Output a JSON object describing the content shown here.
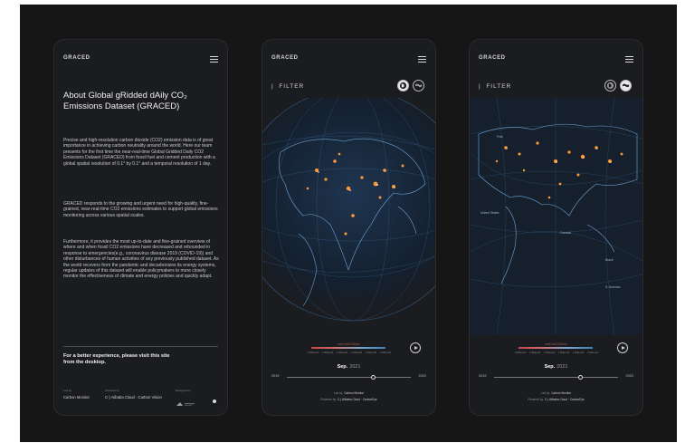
{
  "brand": "GRACED",
  "about": {
    "title_line1": "About Global gRidded dAily CO₂",
    "title_line2": "Emissions Dataset (GRACED)",
    "paragraph1": "Precise and high-resolution carbon dioxide (CO2) emission data is of great importance in achieving carbon neutrality around the world. Here our team presents for the first time the near-real-time Global Gridded Daily CO2 Emissions Dataset (GRACED) from fossil fuel and cement production with a global spatial resolution of 0.1° by 0.1° and a temporal resolution of 1 day.",
    "paragraph2": "GRACED responds to the growing and urgent need for high-quality, fine-grained, near-real-time CO2 emissions estimates to support global emissions monitoring across various spatial scales.",
    "paragraph3": "Furthermore, it provides the most up-to-date and fine-grained overview of where and when fossil CO2 emissions have decreased and rebounded in response to emergencies(e.g., coronavirus disease 2019 (COVID-19)) and other disturbances of human activities of any previously published dataset. As the world recovers from the pandemic and decarbonizes its energy systems, regular updates of this dataset will enable policymakers to more closely monitor the effectiveness of climate and energy policies and quickly adapt.",
    "visit_line1": "For a better experience, please visit this site",
    "visit_line2": "from the desktop.",
    "footer": {
      "led_by_caption": "Led by",
      "led_by": "Carbon Monitor",
      "powered_caption": "Powered by",
      "powered": "C-) Alibaba Cloud · Carbon Vision",
      "designed_caption": "Designed by"
    }
  },
  "map_view": {
    "filter_label": "FILTER",
    "legend_unit": "unit: tonCO2/km²",
    "legend_ticks": [
      "0.000e+00",
      "1.000e+00",
      "1.000e+01",
      "1.000e+02",
      "1.000e+03",
      "1.000e+04"
    ],
    "month": "Sep.",
    "year": "2021",
    "start_year": "2019",
    "end_year": "2022",
    "timeline_position": 0.7,
    "credit_led_caption": "Led by",
    "credit_led": "Carbon Monitor",
    "credit_powered_caption": "Powered by",
    "credit_powered": "C-) Alibaba Cloud · CarbonEye",
    "places": [
      "Pole",
      "United States",
      "Canada",
      "Brazil",
      "S. America"
    ]
  },
  "colors": {
    "background": "#161616",
    "panel": "#1b1c1f",
    "emission_hot": "#ff9a3c",
    "coastline": "#6fa3d8"
  }
}
